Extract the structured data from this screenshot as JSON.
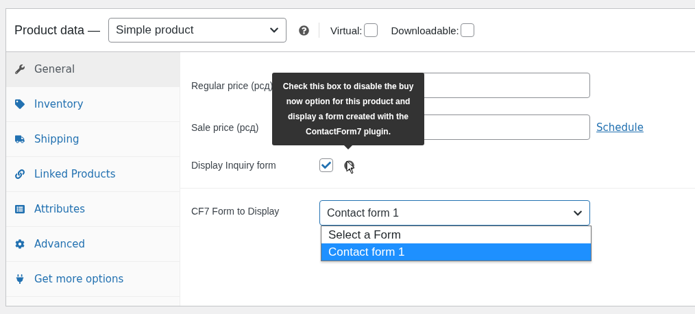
{
  "header": {
    "title": "Product data —",
    "product_type": "Simple product",
    "options": [
      {
        "label": "Virtual:",
        "checked": false
      },
      {
        "label": "Downloadable:",
        "checked": false
      }
    ]
  },
  "sidebar": {
    "items": [
      {
        "label": "General",
        "selected": true
      },
      {
        "label": "Inventory",
        "selected": false
      },
      {
        "label": "Shipping",
        "selected": false
      },
      {
        "label": "Linked Products",
        "selected": false
      },
      {
        "label": "Attributes",
        "selected": false
      },
      {
        "label": "Advanced",
        "selected": false
      },
      {
        "label": "Get more options",
        "selected": false
      }
    ]
  },
  "fields": [
    {
      "kind": "text",
      "label": "Regular price (рсд)"
    },
    {
      "kind": "text",
      "label": "Sale price (рсд)",
      "link": "Schedule"
    },
    {
      "kind": "checkbox",
      "label": "Display Inquiry form",
      "checked": true,
      "help": true
    }
  ],
  "cf7": {
    "label": "CF7 Form to Display",
    "value": "Contact form 1",
    "expanded": true,
    "options": [
      {
        "label": "Select a Form",
        "selected": false
      },
      {
        "label": "Contact form 1",
        "selected": true
      }
    ]
  },
  "tooltip": {
    "text": "Check this box to disable the buy now option for this product and display a form created with the ContactForm7 plugin."
  }
}
